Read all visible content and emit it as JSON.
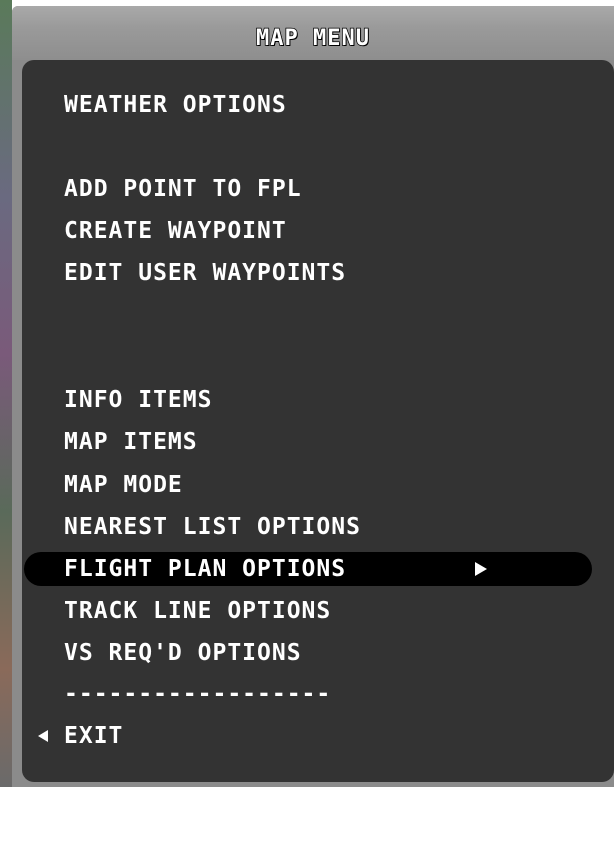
{
  "title": "MAP MENU",
  "menu": {
    "weather_options": "WEATHER OPTIONS",
    "add_point_to_fpl": "ADD POINT TO FPL",
    "create_waypoint": "CREATE WAYPOINT",
    "edit_user_waypoints": "EDIT USER WAYPOINTS",
    "info_items": "INFO ITEMS",
    "map_items": "MAP ITEMS",
    "map_mode": "MAP MODE",
    "nearest_list_options": "NEAREST LIST OPTIONS",
    "flight_plan_options": "FLIGHT PLAN OPTIONS",
    "track_line_options": "TRACK LINE OPTIONS",
    "vs_reqd_options": "VS REQ'D OPTIONS",
    "separator": "------------------",
    "exit": "EXIT"
  },
  "selected_item": "FLIGHT PLAN OPTIONS",
  "icons": {
    "submenu": "triangle-right-icon",
    "back": "triangle-left-icon"
  },
  "colors": {
    "panel": "#333333",
    "title_bar": "#9a9a9a",
    "text": "#ffffff",
    "highlight": "#000000"
  }
}
